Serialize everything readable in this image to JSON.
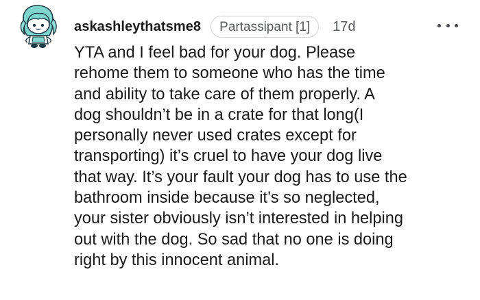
{
  "comment": {
    "username": "askashleythatsme8",
    "flair": "Partassipant [1]",
    "age": "17d",
    "avatar_icon": "snoo-avatar-icon",
    "more_icon": "more-options-icon",
    "body_lines": [
      "YTA and I feel bad for your dog. Please",
      "rehome them to someone who has the time",
      "and ability to take care of them properly. A",
      "dog shouldn’t be in a crate for that long(I",
      "personally never used crates except for",
      "transporting) it’s cruel to have your dog live",
      "that way. It’s your fault your dog has to use the",
      "bathroom inside because it’s so neglected,",
      "your sister obviously isn’t interested in helping",
      "out with the dog. So sad that no one is doing",
      "right by this innocent animal."
    ]
  },
  "colors": {
    "avatar_teal": "#7fd6cf",
    "avatar_dark": "#1c3b44",
    "text": "#1a1a1b",
    "meta": "#57595c",
    "flair_border": "#d0d3d6"
  }
}
